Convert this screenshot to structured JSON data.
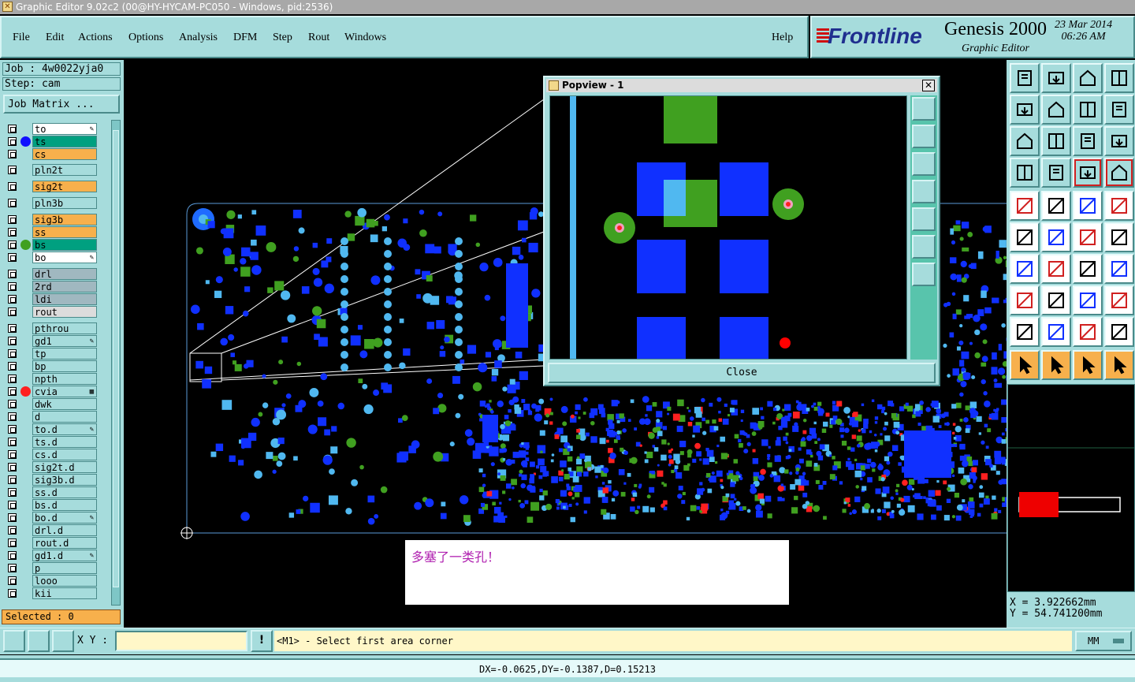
{
  "window": {
    "title": "Graphic Editor 9.02c2 (00@HY-HYCAM-PC050 - Windows, pid:2536)"
  },
  "menu": {
    "items": [
      "File",
      "Edit",
      "Actions",
      "Options",
      "Analysis",
      "DFM",
      "Step",
      "Rout",
      "Windows"
    ],
    "help": "Help"
  },
  "brand": {
    "logo": "Frontline",
    "product": "Genesis 2000",
    "subtitle": "Graphic Editor",
    "date": "23 Mar 2014",
    "time": "06:26 AM"
  },
  "job": {
    "job_line": "Job : 4w0022yja0",
    "step_line": "Step: cam",
    "matrix_button": "Job Matrix ..."
  },
  "layers": [
    {
      "name": "to",
      "color": "#ffffff",
      "dot": "",
      "flag": "edit"
    },
    {
      "name": "ts",
      "color": "#00a080",
      "dot": "#1010ff",
      "flag": ""
    },
    {
      "name": "cs",
      "color": "#f7b04c",
      "dot": "",
      "flag": ""
    },
    {
      "name": "pln2t",
      "color": "#a6dcdc",
      "dot": "",
      "flag": ""
    },
    {
      "name": "sig2t",
      "color": "#f7b04c",
      "dot": "",
      "flag": ""
    },
    {
      "name": "pln3b",
      "color": "#a6dcdc",
      "dot": "",
      "flag": ""
    },
    {
      "name": "sig3b",
      "color": "#f7b04c",
      "dot": "",
      "flag": ""
    },
    {
      "name": "ss",
      "color": "#f7b04c",
      "dot": "",
      "flag": ""
    },
    {
      "name": "bs",
      "color": "#00a080",
      "dot": "#40a020",
      "flag": ""
    },
    {
      "name": "bo",
      "color": "#ffffff",
      "dot": "",
      "flag": "edit"
    },
    {
      "name": "drl",
      "color": "#a0b8c0",
      "dot": "",
      "flag": ""
    },
    {
      "name": "2rd",
      "color": "#a0b8c0",
      "dot": "",
      "flag": ""
    },
    {
      "name": "ldi",
      "color": "#a0b8c0",
      "dot": "",
      "flag": ""
    },
    {
      "name": "rout",
      "color": "#dcdcdc",
      "dot": "",
      "flag": ""
    },
    {
      "name": "pthrou",
      "color": "#a6dcdc",
      "dot": "",
      "flag": ""
    },
    {
      "name": "gd1",
      "color": "#a6dcdc",
      "dot": "",
      "flag": "edit"
    },
    {
      "name": "tp",
      "color": "#a6dcdc",
      "dot": "",
      "flag": ""
    },
    {
      "name": "bp",
      "color": "#a6dcdc",
      "dot": "",
      "flag": ""
    },
    {
      "name": "npth",
      "color": "#a6dcdc",
      "dot": "",
      "flag": ""
    },
    {
      "name": "cvia",
      "color": "#a6dcdc",
      "dot": "#ff2020",
      "flag": "grid"
    },
    {
      "name": "dwk",
      "color": "#a6dcdc",
      "dot": "",
      "flag": ""
    },
    {
      "name": "d",
      "color": "#a6dcdc",
      "dot": "",
      "flag": ""
    },
    {
      "name": "to.d",
      "color": "#a6dcdc",
      "dot": "",
      "flag": "edit"
    },
    {
      "name": "ts.d",
      "color": "#a6dcdc",
      "dot": "",
      "flag": ""
    },
    {
      "name": "cs.d",
      "color": "#a6dcdc",
      "dot": "",
      "flag": ""
    },
    {
      "name": "sig2t.d",
      "color": "#a6dcdc",
      "dot": "",
      "flag": ""
    },
    {
      "name": "sig3b.d",
      "color": "#a6dcdc",
      "dot": "",
      "flag": ""
    },
    {
      "name": "ss.d",
      "color": "#a6dcdc",
      "dot": "",
      "flag": ""
    },
    {
      "name": "bs.d",
      "color": "#a6dcdc",
      "dot": "",
      "flag": ""
    },
    {
      "name": "bo.d",
      "color": "#a6dcdc",
      "dot": "",
      "flag": "edit"
    },
    {
      "name": "drl.d",
      "color": "#a6dcdc",
      "dot": "",
      "flag": ""
    },
    {
      "name": "rout.d",
      "color": "#a6dcdc",
      "dot": "",
      "flag": ""
    },
    {
      "name": "gd1.d",
      "color": "#a6dcdc",
      "dot": "",
      "flag": "edit"
    },
    {
      "name": "p",
      "color": "#a6dcdc",
      "dot": "",
      "flag": ""
    },
    {
      "name": "looo",
      "color": "#a6dcdc",
      "dot": "",
      "flag": ""
    },
    {
      "name": "kii",
      "color": "#a6dcdc",
      "dot": "",
      "flag": ""
    }
  ],
  "selected": "Selected : 0",
  "popview": {
    "title": "Popview - 1",
    "close_x": "✕",
    "close_button": "Close"
  },
  "annotation": "多塞了一类孔！",
  "coords": {
    "x": "X = 3.922662mm",
    "y": "Y = 54.741200mm"
  },
  "bottom": {
    "xy_label": "X Y :",
    "xy_value": "",
    "alert_icon": "!",
    "prompt": "<M1> - Select first area corner",
    "units": "MM",
    "distance": "DX=-0.0625,DY=-0.1387,D=0.15213"
  },
  "colors": {
    "panel": "#a6dcdc",
    "pad_blue": "#1030ff",
    "pad_green": "#40a020",
    "pad_light": "#50b8f0",
    "highlight": "#f7b04c"
  }
}
